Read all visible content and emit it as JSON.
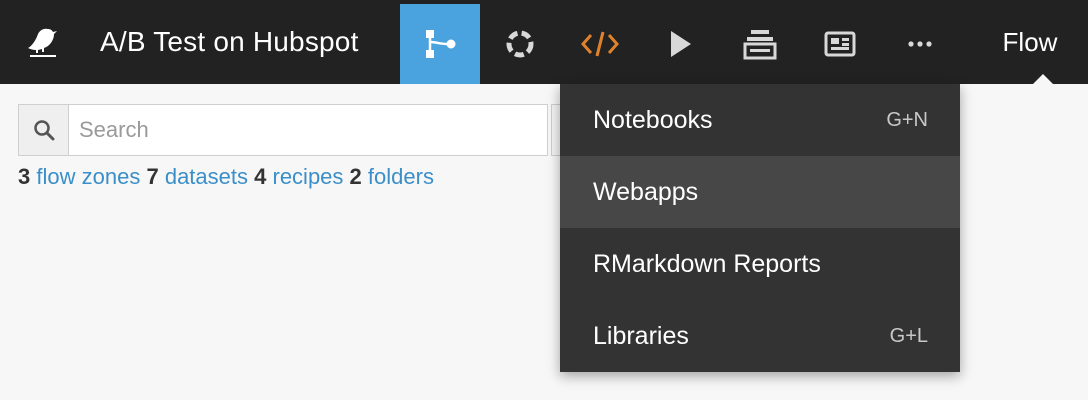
{
  "header": {
    "project_title": "A/B Test on Hubspot",
    "current_view": "Flow",
    "nav_icons": [
      "flow-icon",
      "lab-icon",
      "code-icon",
      "play-icon",
      "jobs-icon",
      "dashboard-icon",
      "more-icon"
    ],
    "accent_color": "#4aa3df",
    "code_icon_color": "#e0822a"
  },
  "search": {
    "placeholder": "Search",
    "value": ""
  },
  "summary": {
    "flow_zones_count": "3",
    "flow_zones_label": "flow zones",
    "datasets_count": "7",
    "datasets_label": "datasets",
    "recipes_count": "4",
    "recipes_label": "recipes",
    "folders_count": "2",
    "folders_label": "folders"
  },
  "code_menu": {
    "items": [
      {
        "label": "Notebooks",
        "shortcut": "G+N"
      },
      {
        "label": "Webapps",
        "shortcut": ""
      },
      {
        "label": "RMarkdown Reports",
        "shortcut": ""
      },
      {
        "label": "Libraries",
        "shortcut": "G+L"
      }
    ],
    "highlighted": "Webapps"
  }
}
